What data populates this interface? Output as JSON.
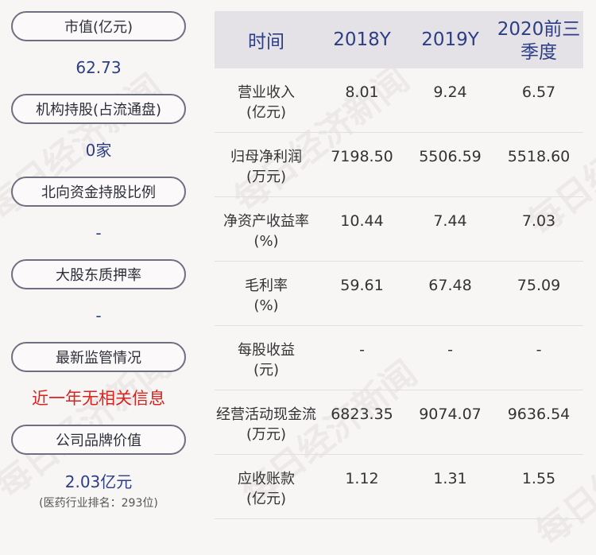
{
  "left": [
    {
      "label": "市值(亿元)",
      "value": "62.73"
    },
    {
      "label": "机构持股(占流通盘)",
      "value": "0家"
    },
    {
      "label": "北向资金持股比例",
      "value": "-"
    },
    {
      "label": "大股东质押率",
      "value": "-"
    },
    {
      "label": "最新监管情况",
      "value": "近一年无相关信息"
    },
    {
      "label": "公司品牌价值",
      "value": "2.03亿元",
      "sub": "(医药行业排名：293位)"
    }
  ],
  "table": {
    "headers": [
      "时间",
      "2018Y",
      "2019Y",
      "2020前三季度"
    ],
    "rows": [
      {
        "name": "营业收入",
        "unit": "(亿元)",
        "v": [
          "8.01",
          "9.24",
          "6.57"
        ]
      },
      {
        "name": "归母净利润",
        "unit": "(万元)",
        "v": [
          "7198.50",
          "5506.59",
          "5518.60"
        ]
      },
      {
        "name": "净资产收益率",
        "unit": "(%)",
        "v": [
          "10.44",
          "7.44",
          "7.03"
        ]
      },
      {
        "name": "毛利率",
        "unit": "(%)",
        "v": [
          "59.61",
          "67.48",
          "75.09"
        ]
      },
      {
        "name": "每股收益",
        "unit": "(元)",
        "v": [
          "-",
          "-",
          "-"
        ]
      },
      {
        "name": "经营活动现金流",
        "unit": "(万元)",
        "v": [
          "6823.35",
          "9074.07",
          "9636.54"
        ]
      },
      {
        "name": "应收账款",
        "unit": "(亿元)",
        "v": [
          "1.12",
          "1.31",
          "1.55"
        ]
      }
    ]
  },
  "watermark": "每日经济新闻",
  "colors": {
    "accent": "#2c3e85",
    "alert": "#d9231f",
    "header_bg": "#e4e2e6"
  }
}
